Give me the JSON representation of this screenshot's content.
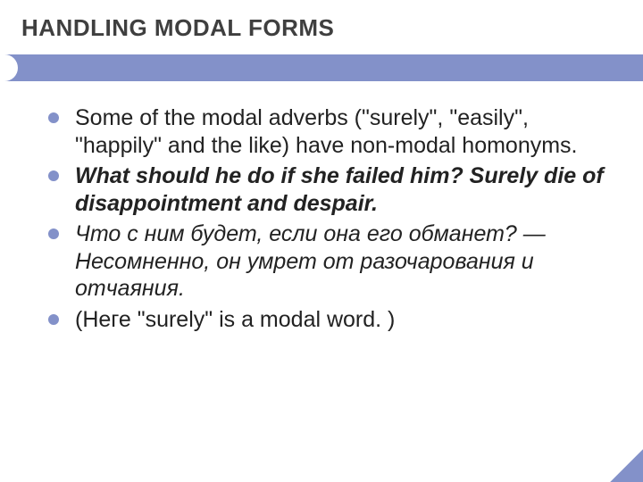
{
  "slide": {
    "title": "HANDLING MODAL FORMS",
    "bullets": [
      {
        "text": "Some of the modal adverbs (\"surely\", \"easily\", \"happily\" and the like) have non-modal homonyms.",
        "style": "plain"
      },
      {
        "text": "What should he do if she failed him? Surely die of disappointment and despair.",
        "style": "bold-italic"
      },
      {
        "text": "Что с ним будет, если она его обманет? — Несомненно, он умрет от разочарования и отчаяния.",
        "style": "italic"
      },
      {
        "text": "(Неге \"surely\" is a modal word. )",
        "style": "plain"
      }
    ]
  },
  "colors": {
    "accent": "#8391c9",
    "text": "#3f3f3f"
  }
}
